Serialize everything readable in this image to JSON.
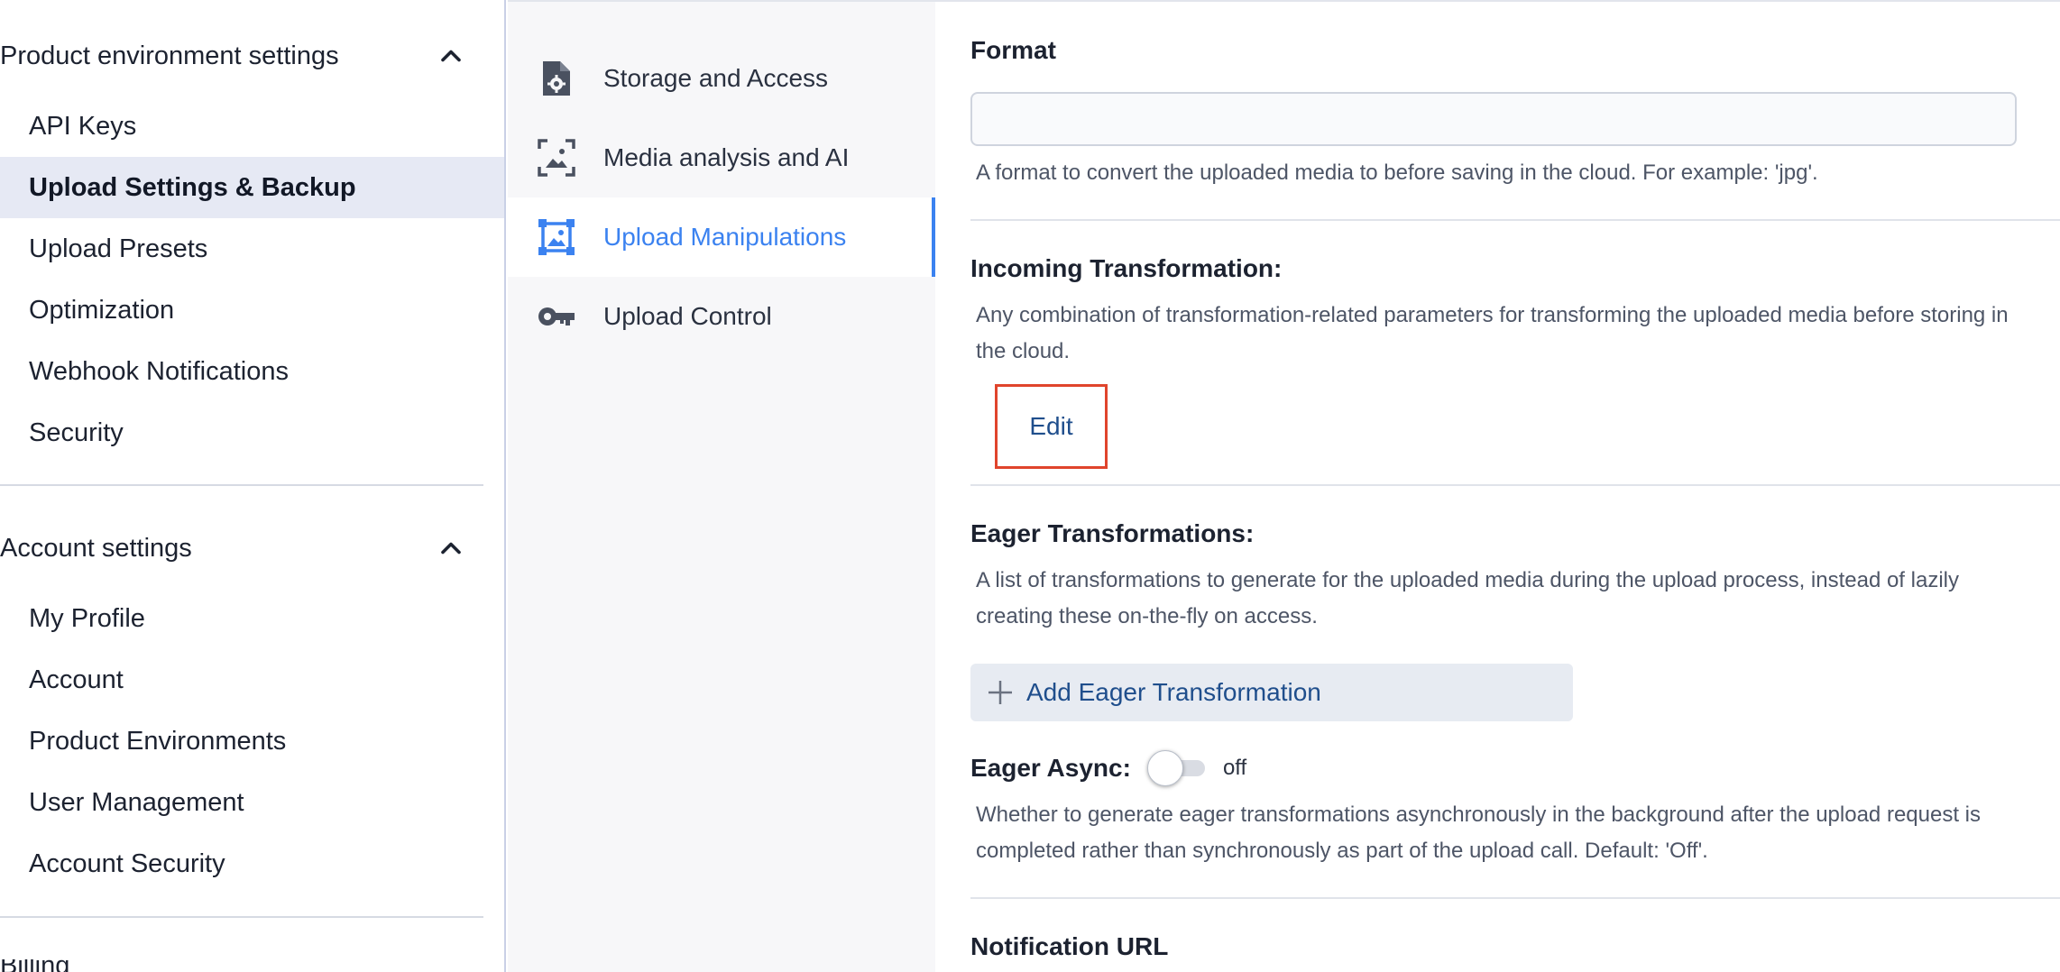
{
  "sidebar": {
    "product_section": {
      "title": "Product environment settings",
      "items": [
        {
          "label": "API Keys"
        },
        {
          "label": "Upload Settings & Backup"
        },
        {
          "label": "Upload Presets"
        },
        {
          "label": "Optimization"
        },
        {
          "label": "Webhook Notifications"
        },
        {
          "label": "Security"
        }
      ]
    },
    "account_section": {
      "title": "Account settings",
      "items": [
        {
          "label": "My Profile"
        },
        {
          "label": "Account"
        },
        {
          "label": "Product Environments"
        },
        {
          "label": "User Management"
        },
        {
          "label": "Account Security"
        }
      ]
    },
    "next_section_partial": "Billing"
  },
  "subnav": {
    "items": [
      {
        "label": "Storage and Access",
        "icon": "file-gear-icon"
      },
      {
        "label": "Media analysis and AI",
        "icon": "image-scan-icon"
      },
      {
        "label": "Upload Manipulations",
        "icon": "image-frame-icon"
      },
      {
        "label": "Upload Control",
        "icon": "key-icon"
      }
    ],
    "active": "Upload Manipulations"
  },
  "main": {
    "format": {
      "title": "Format",
      "value": "",
      "help": "A format to convert the uploaded media to before saving in the cloud. For example: 'jpg'."
    },
    "incoming": {
      "title": "Incoming Transformation:",
      "help_line1": "Any combination of transformation-related parameters for transforming the uploaded media before storing in",
      "help_line2": "the cloud.",
      "edit_label": "Edit"
    },
    "eager": {
      "title": "Eager Transformations:",
      "help_line1": "A list of transformations to generate for the uploaded media during the upload process, instead of lazily",
      "help_line2": "creating these on-the-fly on access.",
      "add_label": "Add Eager Transformation"
    },
    "eager_async": {
      "title": "Eager Async:",
      "state": "off",
      "help_line1": "Whether to generate eager transformations asynchronously in the background after the upload request is",
      "help_line2": "completed rather than synchronously as part of the upload call. Default: 'Off'."
    },
    "notification": {
      "title": "Notification URL"
    }
  },
  "colors": {
    "accent": "#3b82f0",
    "link": "#1f4e8c",
    "highlight_box": "#e0442c",
    "active_bg": "#e6e9f4"
  }
}
